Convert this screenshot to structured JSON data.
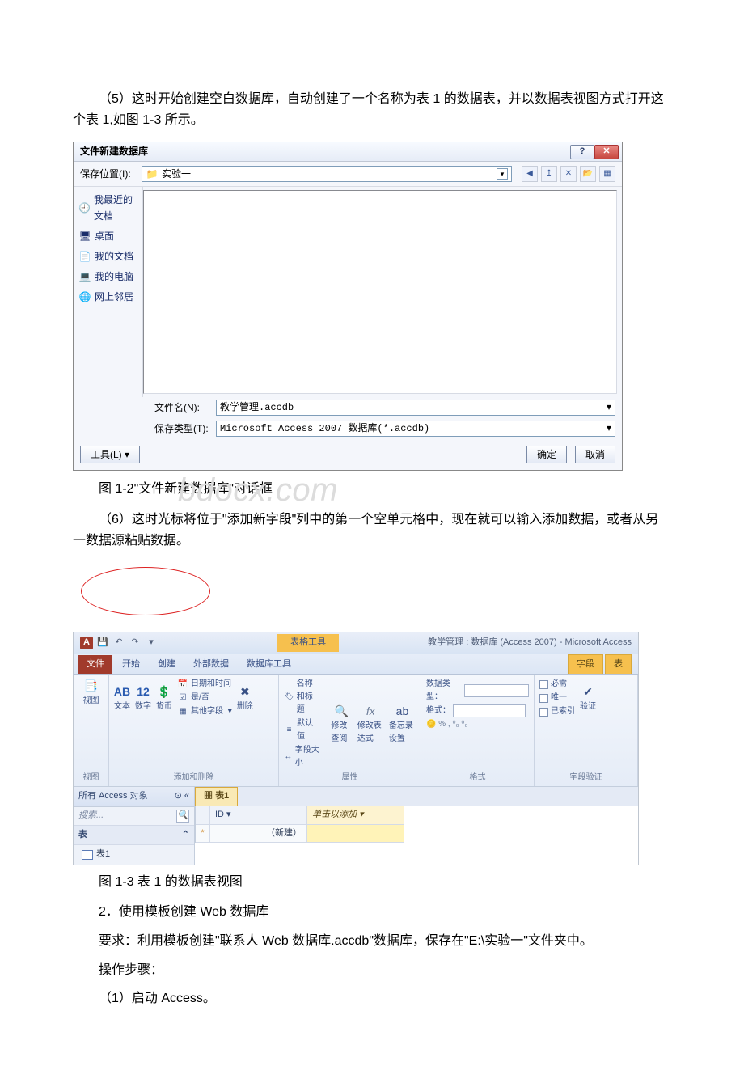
{
  "paragraphs": {
    "p5": "（5）这时开始创建空白数据库，自动创建了一个名称为表 1 的数据表，并以数据表视图方式打开这个表 1,如图 1-3 所示。",
    "p6": "（6）这时光标将位于\"添加新字段\"列中的第一个空单元格中，现在就可以输入添加数据，或者从另一数据源粘贴数据。",
    "fig12": "图 1-2\"文件新建数据库\"对话框",
    "fig13": "图 1-3 表 1 的数据表视图",
    "p2num": "2．使用模板创建 Web 数据库",
    "req": "要求：利用模板创建\"联系人 Web 数据库.accdb\"数据库，保存在\"E:\\实验一\"文件夹中。",
    "steps": "操作步骤：",
    "s1": "（1）启动 Access。"
  },
  "watermark": "bdocx.com",
  "dialog": {
    "title": "文件新建数据库",
    "savein_label": "保存位置(I):",
    "savein_value": "实验一",
    "places": [
      "我最近的文档",
      "桌面",
      "我的文档",
      "我的电脑",
      "网上邻居"
    ],
    "filename_label": "文件名(N):",
    "filename_value": "教学管理.accdb",
    "filetype_label": "保存类型(T):",
    "filetype_value": "Microsoft Access 2007 数据库(*.accdb)",
    "tools_btn": "工具(L)",
    "ok_btn": "确定",
    "cancel_btn": "取消"
  },
  "access": {
    "title_right": "教学管理 : 数据库 (Access 2007) - Microsoft Access",
    "ctx_header": "表格工具",
    "tabs": {
      "file": "文件",
      "home": "开始",
      "create": "创建",
      "ext": "外部数据",
      "dbtool": "数据库工具",
      "fields": "字段",
      "table": "表"
    },
    "grp_view": "视图",
    "btn_view": "视图",
    "grp_adddel": "添加和删除",
    "btn_text": "文本",
    "btn_num": "数字",
    "btn_cur": "货币",
    "btn_datetime": "日期和时间",
    "btn_yesno": "是/否",
    "btn_more": "其他字段",
    "btn_delete": "删除",
    "grp_props": "属性",
    "btn_namecap": "名称和标题",
    "btn_default": "默认值",
    "btn_size": "字段大小",
    "btn_modlookup": "修改查阅",
    "btn_modexpr": "修改表达式",
    "btn_memo": "备忘录设置",
    "grp_format": "格式",
    "lbl_datatype": "数据类型：",
    "lbl_format": "格式：",
    "fmt_placeholder": "格式",
    "grp_valid": "字段验证",
    "chk_req": "必需",
    "chk_unique": "唯一",
    "chk_indexed": "已索引",
    "btn_valid": "验证",
    "nav_header": "所有 Access 对象",
    "nav_search": "搜索...",
    "nav_group": "表",
    "nav_item": "表1",
    "sheet_tab": "表1",
    "col_id": "ID",
    "col_add": "单击以添加",
    "row_new": "（新建）"
  }
}
